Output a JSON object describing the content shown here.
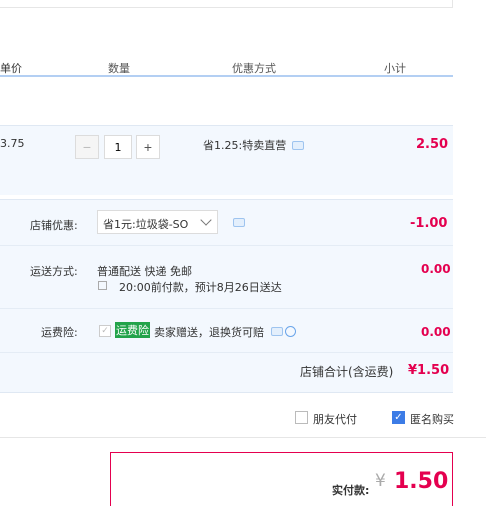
{
  "columns": {
    "unit_price": "单价",
    "quantity": "数量",
    "discount_method": "优惠方式",
    "subtotal": "小计"
  },
  "item": {
    "unit_price": "3.75",
    "quantity": "1",
    "minus": "−",
    "plus": "+",
    "discount": "省1.25:特卖直营",
    "subtotal": "2.50"
  },
  "store_discount": {
    "label": "店铺优惠:",
    "selected": "省1元:垃圾袋-SO",
    "amount": "-1.00"
  },
  "shipping": {
    "label": "运送方式:",
    "method": "普通配送 快递 免邮",
    "note": "20:00前付款，预计8月26日送达",
    "amount": "0.00"
  },
  "insurance": {
    "label": "运费险:",
    "badge": "运费险",
    "desc": "卖家赠送，退换货可赔",
    "amount": "0.00"
  },
  "store_total": {
    "label": "店铺合计(含运费)",
    "amount": "¥1.50"
  },
  "options": {
    "friend_pay": "朋友代付",
    "anonymous": "匿名购买"
  },
  "payment": {
    "label": "实付款:",
    "currency": "¥",
    "amount": "1.50"
  },
  "colors": {
    "accent_red": "#e4004f",
    "panel_blue": "#f3f8fe",
    "brand_blue": "#3c7ce6",
    "badge_green": "#22a34a"
  }
}
